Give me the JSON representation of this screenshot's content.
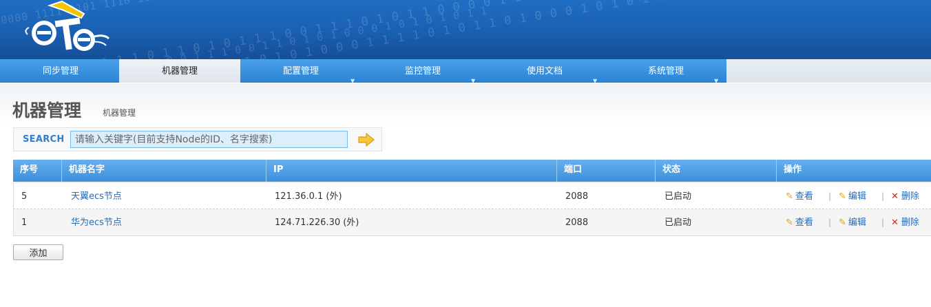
{
  "nav": {
    "items": [
      {
        "label": "同步管理",
        "dropdown": false,
        "active": false
      },
      {
        "label": "机器管理",
        "dropdown": false,
        "active": true
      },
      {
        "label": "配置管理",
        "dropdown": true,
        "active": false
      },
      {
        "label": "监控管理",
        "dropdown": true,
        "active": false
      },
      {
        "label": "使用文档",
        "dropdown": true,
        "active": false
      },
      {
        "label": "系统管理",
        "dropdown": true,
        "active": false
      }
    ]
  },
  "page": {
    "title": "机器管理",
    "subtitle": "机器管理"
  },
  "search": {
    "label": "SEARCH",
    "placeholder": "请输入关键字(目前支持Node的ID、名字搜索)",
    "go_icon": "arrow-right-icon"
  },
  "table": {
    "headers": [
      "序号",
      "机器名字",
      "IP",
      "端口",
      "状态",
      "操作"
    ],
    "rows": [
      {
        "id": "5",
        "name": "天翼ecs节点",
        "ip": "121.36.0.1 (外)",
        "port": "2088",
        "status": "已启动"
      },
      {
        "id": "1",
        "name": "华为ecs节点",
        "ip": "124.71.226.30 (外)",
        "port": "2088",
        "status": "已启动"
      }
    ],
    "actions": {
      "view": "查看",
      "edit": "编辑",
      "delete": "删除",
      "separator": "|"
    }
  },
  "buttons": {
    "add": "添加"
  },
  "colors": {
    "header_blue": "#1f6fc4",
    "nav_blue": "#3b8fda",
    "link_blue": "#2a6ab6",
    "delete_red": "#d9241c"
  }
}
